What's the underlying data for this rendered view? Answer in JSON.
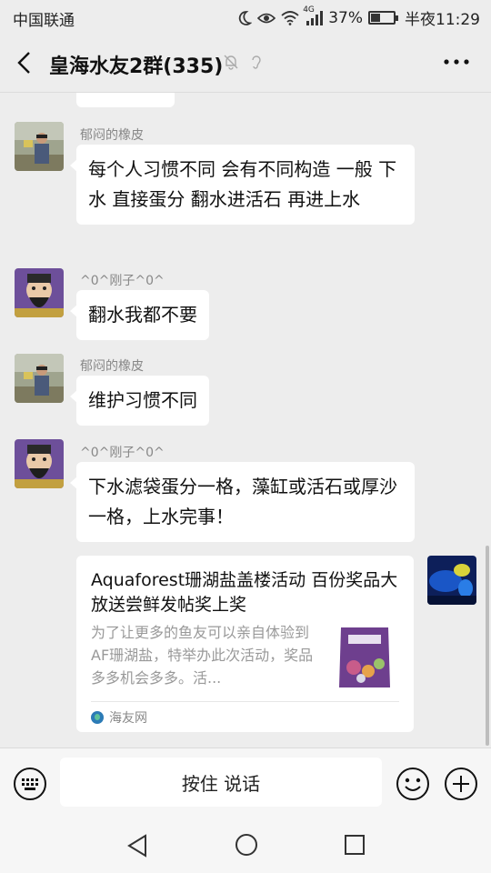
{
  "status_bar": {
    "carrier": "中国联通",
    "network": "4G",
    "battery": "37%",
    "battery_level": 0.37,
    "time": "半夜11:29"
  },
  "header": {
    "title": "皇海水友2群(335)"
  },
  "messages": [
    {
      "sender": "郁闷的橡皮",
      "text": "每个人习惯不同  会有不同构造  一般  下水 直接蛋分  翻水进活石   再进上水"
    },
    {
      "sender": "^0^刚子^0^",
      "text": "翻水我都不要"
    },
    {
      "sender": "郁闷的橡皮",
      "text": "维护习惯不同"
    },
    {
      "sender": "^0^刚子^0^",
      "text": "下水滤袋蛋分一格，藻缸或活石或厚沙一格，上水完事！"
    }
  ],
  "link_card": {
    "title": "Aquaforest珊湖盐盖楼活动 百份奖品大放送尝鲜发帖奖上奖",
    "description": "为了让更多的鱼友可以亲自体验到AF珊湖盐，特举办此次活动，奖品多多机会多多。活...",
    "source": "海友网"
  },
  "input_bar": {
    "hold_to_talk": "按住 说话"
  },
  "colors": {
    "background": "#ededed",
    "bubble": "#ffffff"
  }
}
